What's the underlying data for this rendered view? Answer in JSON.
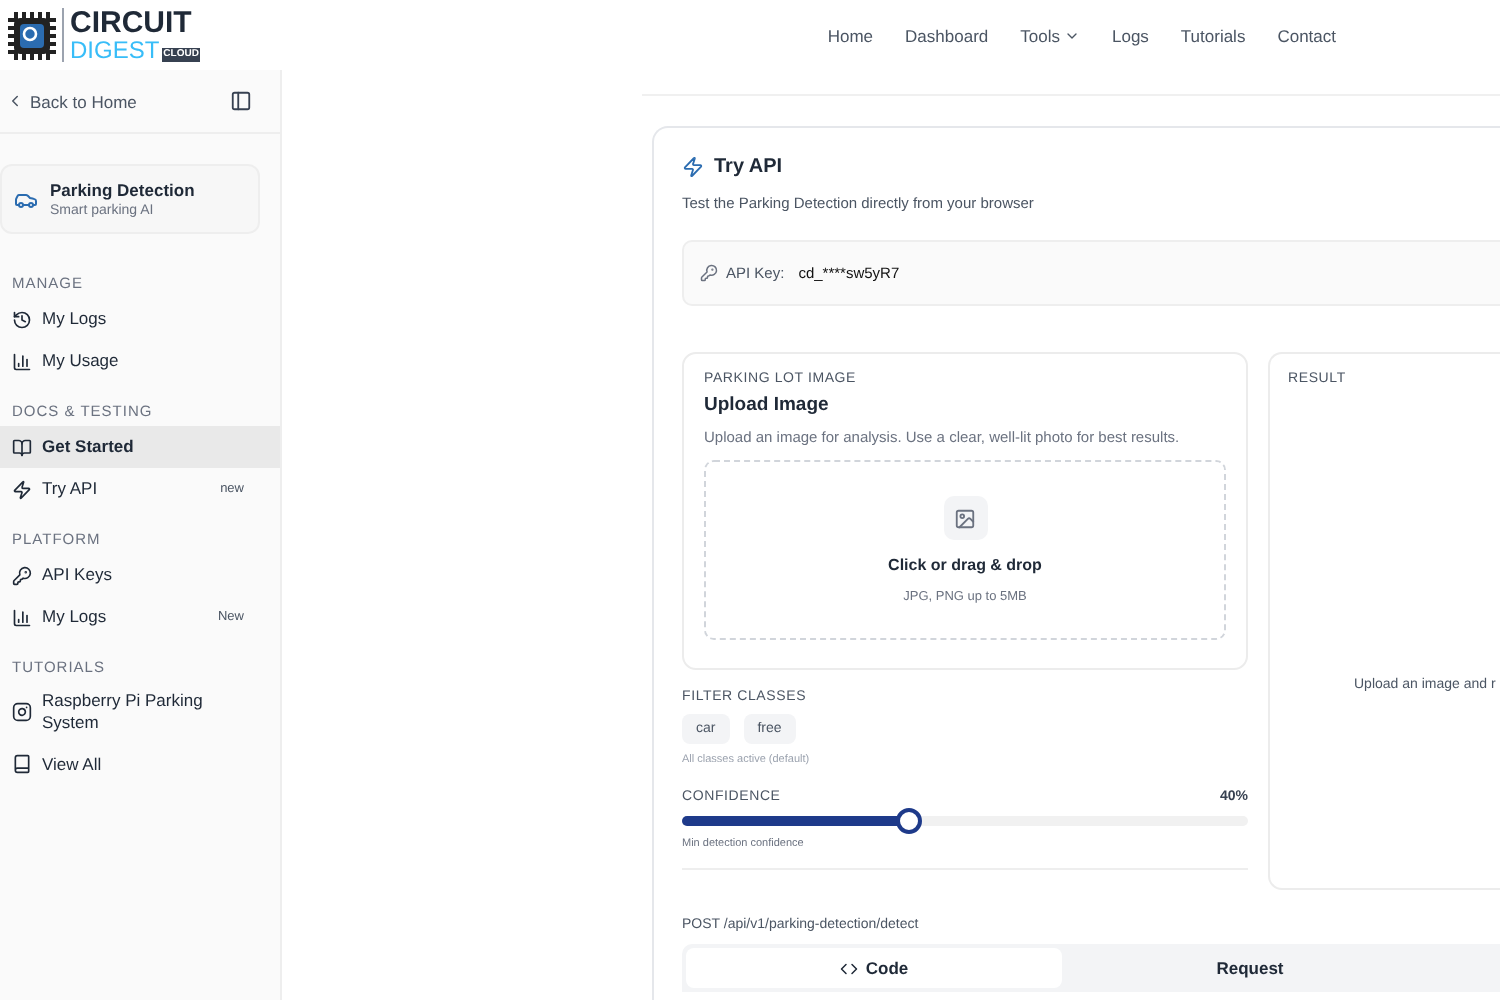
{
  "logo": {
    "line_1": "CIRCUIT",
    "line_2": "DIGEST",
    "tag": "CLOUD"
  },
  "nav": [
    {
      "label": "Home",
      "dropdown": false
    },
    {
      "label": "Dashboard",
      "dropdown": false
    },
    {
      "label": "Tools",
      "dropdown": true
    },
    {
      "label": "Logs",
      "dropdown": false
    },
    {
      "label": "Tutorials",
      "dropdown": false
    },
    {
      "label": "Contact",
      "dropdown": false
    }
  ],
  "sidebar": {
    "back": "Back to Home",
    "project": {
      "title": "Parking Detection",
      "subtitle": "Smart parking AI"
    },
    "sections": [
      {
        "title": "MANAGE",
        "items": [
          {
            "label": "My Logs",
            "selected": false
          },
          {
            "label": "My Usage",
            "selected": false
          }
        ]
      },
      {
        "title": "DOCS & TESTING",
        "items": [
          {
            "label": "Get Started",
            "selected": true
          },
          {
            "label": "Try API",
            "selected": false,
            "badge": "new"
          }
        ]
      },
      {
        "title": "PLATFORM",
        "items": [
          {
            "label": "API Keys",
            "selected": false
          },
          {
            "label": "My Logs",
            "selected": false,
            "badge": "New"
          }
        ]
      },
      {
        "title": "TUTORIALS",
        "items": [
          {
            "label": "Raspberry Pi Parking System",
            "selected": false
          },
          {
            "label": "View All",
            "selected": false
          }
        ]
      }
    ]
  },
  "card": {
    "title": "Try API",
    "subtitle": "Test the Parking Detection directly from your browser",
    "api_key_label": "API Key:",
    "api_key": "cd_****sw5yR7",
    "upload": {
      "eyebrow": "PARKING LOT IMAGE",
      "title": "Upload Image",
      "description": "Upload an image for analysis. Use a clear, well-lit photo for best results.",
      "drop_title": "Click or drag & drop",
      "drop_hint": "JPG, PNG up to 5MB"
    },
    "filter": {
      "label": "FILTER CLASSES",
      "classes": [
        {
          "label": "car",
          "selected": false
        },
        {
          "label": "free",
          "selected": false
        }
      ],
      "hint": "All classes active (default)"
    },
    "confidence": {
      "label": "CONFIDENCE",
      "reading": "40%",
      "level": 0.4,
      "hint": "Min detection confidence"
    },
    "result": {
      "label": "RESULT",
      "empty_text": "Upload an image and r"
    },
    "endpoint": "POST /api/v1/parking-detection/detect",
    "tabs": [
      {
        "label": "Code",
        "selected": true
      },
      {
        "label": "Request",
        "selected": false
      }
    ]
  }
}
